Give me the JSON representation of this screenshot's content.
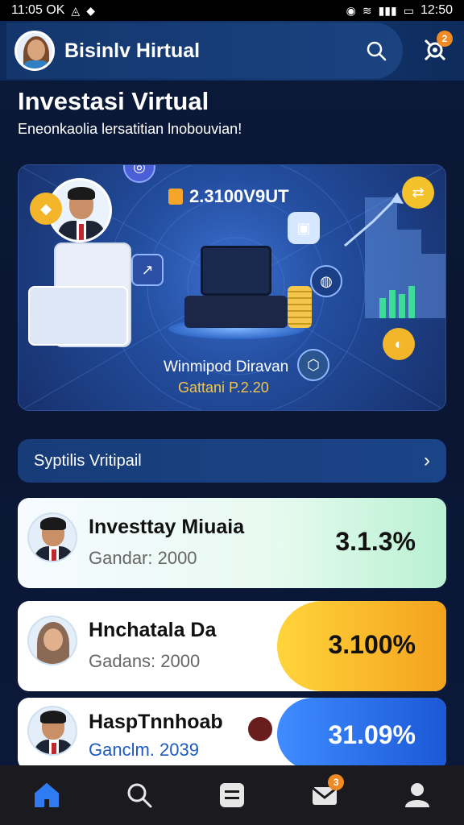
{
  "status_bar": {
    "time": "11:05 OK",
    "right_time": "12:50"
  },
  "header": {
    "app_title": "Bisinlv Hirtual",
    "notification_count": "2"
  },
  "page": {
    "title": "Investasi Virtual",
    "subtitle": "Eneonkaolia lersatitian lnobouvian!"
  },
  "hero": {
    "stat_value": "2.3100V9UT",
    "caption": "Winmipod Diravan",
    "caption_sub": "Gattani P.2.20"
  },
  "section": {
    "label": "Syptilis Vritipail"
  },
  "investments": [
    {
      "name": "Investtay Miuaia",
      "sub": "Gandar: 2000",
      "rate": "3.1.3%"
    },
    {
      "name": "Hnchatala Da",
      "sub": "Gadans: 2000",
      "rate": "3.100%"
    },
    {
      "name": "HaspTnnhoab",
      "sub": "Ganclm. 2039",
      "rate": "31.09%"
    }
  ],
  "nav": {
    "mail_badge": "3"
  },
  "colors": {
    "accent": "#1d4f9e",
    "highlight_gold": "#f3a21e",
    "highlight_blue": "#1c58d6",
    "highlight_green": "#b8f0d2"
  },
  "icons": [
    "home-icon",
    "search-icon",
    "menu-icon",
    "mail-icon",
    "profile-icon"
  ]
}
